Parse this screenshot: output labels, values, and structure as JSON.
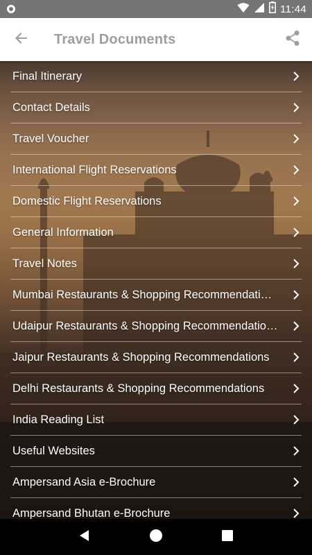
{
  "status_bar": {
    "time": "11:44"
  },
  "app_bar": {
    "title": "Travel Documents",
    "back_icon": "arrow-back-icon",
    "share_icon": "share-icon"
  },
  "documents": [
    {
      "label": "Final Itinerary"
    },
    {
      "label": "Contact Details"
    },
    {
      "label": "Travel Voucher"
    },
    {
      "label": "International Flight Reservations"
    },
    {
      "label": "Domestic Flight Reservations"
    },
    {
      "label": "General Information"
    },
    {
      "label": "Travel Notes"
    },
    {
      "label": "Mumbai Restaurants & Shopping Recommendati…"
    },
    {
      "label": "Udaipur Restaurants & Shopping Recommendatio…"
    },
    {
      "label": "Jaipur Restaurants & Shopping Recommendations"
    },
    {
      "label": "Delhi Restaurants & Shopping Recommendations"
    },
    {
      "label": "India Reading List"
    },
    {
      "label": "Useful Websites"
    },
    {
      "label": "Ampersand Asia e-Brochure"
    },
    {
      "label": "Ampersand Bhutan e-Brochure"
    }
  ],
  "colors": {
    "status_bar": "#757575",
    "app_bar": "#ffffff",
    "title": "#9e9e9e",
    "list_text": "#ffffff"
  }
}
